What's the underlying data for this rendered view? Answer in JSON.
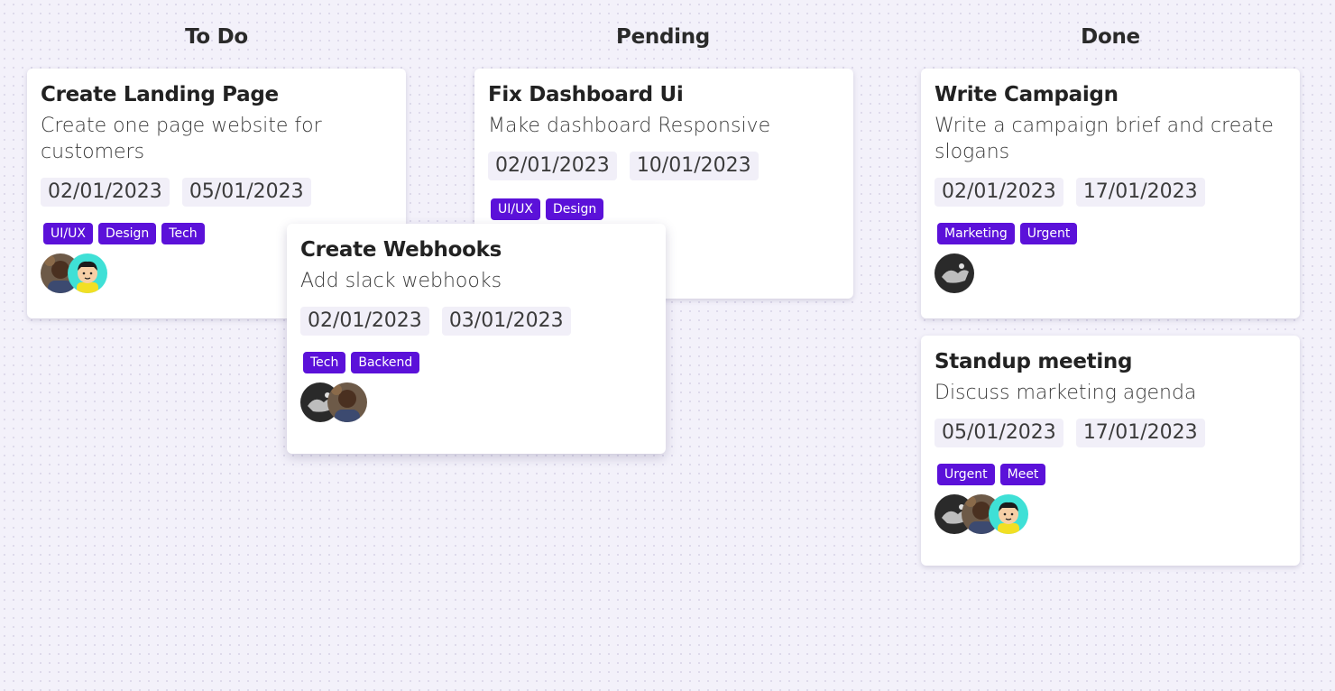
{
  "columns": [
    {
      "title": "To Do"
    },
    {
      "title": "Pending"
    },
    {
      "title": "Done"
    }
  ],
  "cards": {
    "landing": {
      "title": "Create Landing Page",
      "description": "Create one page website for customers",
      "dates": [
        "02/01/2023",
        "05/01/2023"
      ],
      "tags": [
        "UI/UX",
        "Design",
        "Tech"
      ]
    },
    "dashboard": {
      "title": "Fix Dashboard Ui",
      "description": "Make dashboard Responsive",
      "dates": [
        "02/01/2023",
        "10/01/2023"
      ],
      "tags": [
        "UI/UX",
        "Design"
      ]
    },
    "webhooks": {
      "title": "Create Webhooks",
      "description": "Add slack webhooks",
      "dates": [
        "02/01/2023",
        "03/01/2023"
      ],
      "tags": [
        "Tech",
        "Backend"
      ]
    },
    "campaign": {
      "title": "Write Campaign",
      "description": "Write a campaign brief and create slogans",
      "dates": [
        "02/01/2023",
        "17/01/2023"
      ],
      "tags": [
        "Marketing",
        "Urgent"
      ]
    },
    "standup": {
      "title": "Standup meeting",
      "description": "Discuss marketing agenda",
      "dates": [
        "05/01/2023",
        "17/01/2023"
      ],
      "tags": [
        "Urgent",
        "Meet"
      ]
    }
  },
  "colors": {
    "background": "#f3f1fa",
    "tag": "#5b11d9",
    "date_chip": "#f1eff8",
    "card": "#ffffff"
  },
  "avatar_icons": [
    "photo-avatar-icon",
    "cartoon-avatar-icon",
    "dark-avatar-icon"
  ]
}
